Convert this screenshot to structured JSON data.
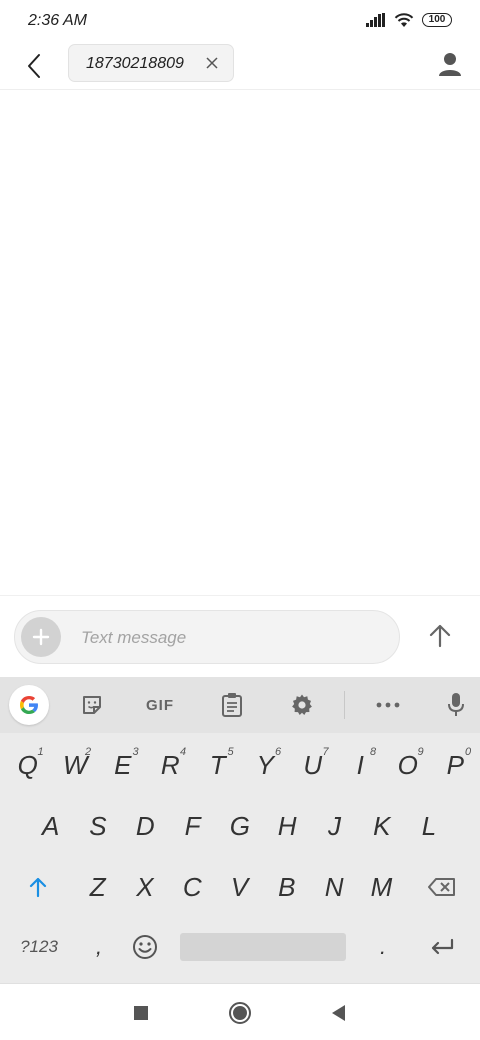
{
  "status_bar": {
    "time": "2:36 AM",
    "battery": "100",
    "icons": [
      "signal-icon",
      "wifi-icon",
      "battery-icon"
    ]
  },
  "header": {
    "recipient": "18730218809"
  },
  "compose": {
    "placeholder": "Text message"
  },
  "keyboard": {
    "toolbar": {
      "gif_label": "GIF"
    },
    "row1": [
      {
        "key": "Q",
        "hint": "1"
      },
      {
        "key": "W",
        "hint": "2"
      },
      {
        "key": "E",
        "hint": "3"
      },
      {
        "key": "R",
        "hint": "4"
      },
      {
        "key": "T",
        "hint": "5"
      },
      {
        "key": "Y",
        "hint": "6"
      },
      {
        "key": "U",
        "hint": "7"
      },
      {
        "key": "I",
        "hint": "8"
      },
      {
        "key": "O",
        "hint": "9"
      },
      {
        "key": "P",
        "hint": "0"
      }
    ],
    "row2": [
      "A",
      "S",
      "D",
      "F",
      "G",
      "H",
      "J",
      "K",
      "L"
    ],
    "row3": [
      "Z",
      "X",
      "C",
      "V",
      "B",
      "N",
      "M"
    ],
    "row4": {
      "symbols_label": "?123",
      "comma": ",",
      "period": "."
    }
  },
  "colors": {
    "accent": "#1a8fe3",
    "keyboard_bg": "#ebebeb",
    "toolbar_bg": "#e3e3e3"
  }
}
